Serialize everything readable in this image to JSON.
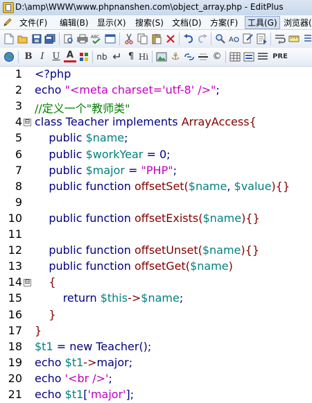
{
  "window": {
    "title": "D:\\amp\\WWW\\www.phpnanshen.com\\object_array.php - EditPlus"
  },
  "menu": {
    "items": [
      "文件(F)",
      "编辑(B)",
      "显示(X)",
      "搜索(S)",
      "文档(D)",
      "方案(F)",
      "工具(G)",
      "浏览器("
    ],
    "active": "工具(G)"
  },
  "toolbar2": {
    "nb": "nb",
    "hi": "Hi",
    "pre": "PRE"
  },
  "editor": {
    "line_numbers": [
      "1",
      "2",
      "3",
      "4",
      "5",
      "6",
      "7",
      "8",
      "9",
      "10",
      "11",
      "12",
      "13",
      "14",
      "15",
      "16",
      "17",
      "18",
      "19",
      "20",
      "21"
    ],
    "fold_markers": [
      "⊟",
      "⊟"
    ],
    "lines": [
      [
        {
          "t": "<?php",
          "c": "kw"
        }
      ],
      [
        {
          "t": "echo ",
          "c": "kw"
        },
        {
          "t": "\"<meta charset='utf-8' />\"",
          "c": "str"
        },
        {
          "t": ";",
          "c": "kw"
        }
      ],
      [
        {
          "t": "//定义一个\"教师类\"",
          "c": "cmt"
        }
      ],
      [
        {
          "t": "class Teacher implements ",
          "c": "kw"
        },
        {
          "t": "ArrayAccess",
          "c": "fn"
        },
        {
          "t": "{",
          "c": "op"
        }
      ],
      [
        {
          "t": "    public ",
          "c": "kw"
        },
        {
          "t": "$name",
          "c": "var"
        },
        {
          "t": ";",
          "c": "kw"
        }
      ],
      [
        {
          "t": "    public ",
          "c": "kw"
        },
        {
          "t": "$workYear",
          "c": "var"
        },
        {
          "t": " = 0;",
          "c": "kw"
        }
      ],
      [
        {
          "t": "    public ",
          "c": "kw"
        },
        {
          "t": "$major",
          "c": "var"
        },
        {
          "t": " = ",
          "c": "kw"
        },
        {
          "t": "\"PHP\"",
          "c": "str"
        },
        {
          "t": ";",
          "c": "kw"
        }
      ],
      [
        {
          "t": "    public function ",
          "c": "kw"
        },
        {
          "t": "offsetSet(",
          "c": "fn"
        },
        {
          "t": "$name",
          "c": "var"
        },
        {
          "t": ", ",
          "c": "kw"
        },
        {
          "t": "$value",
          "c": "var"
        },
        {
          "t": "){}",
          "c": "fn"
        }
      ],
      [
        {
          "t": "",
          "c": "kw"
        }
      ],
      [
        {
          "t": "    public function ",
          "c": "kw"
        },
        {
          "t": "offsetExists(",
          "c": "fn"
        },
        {
          "t": "$name",
          "c": "var"
        },
        {
          "t": "){}",
          "c": "fn"
        }
      ],
      [
        {
          "t": "",
          "c": "kw"
        }
      ],
      [
        {
          "t": "    public function ",
          "c": "kw"
        },
        {
          "t": "offsetUnset(",
          "c": "fn"
        },
        {
          "t": "$name",
          "c": "var"
        },
        {
          "t": "){}",
          "c": "fn"
        }
      ],
      [
        {
          "t": "    public function ",
          "c": "kw"
        },
        {
          "t": "offsetGet(",
          "c": "fn"
        },
        {
          "t": "$name",
          "c": "var"
        },
        {
          "t": ")",
          "c": "fn"
        }
      ],
      [
        {
          "t": "    {",
          "c": "op"
        }
      ],
      [
        {
          "t": "        return ",
          "c": "kw"
        },
        {
          "t": "$this",
          "c": "var"
        },
        {
          "t": "->",
          "c": "op"
        },
        {
          "t": "$name",
          "c": "var"
        },
        {
          "t": ";",
          "c": "kw"
        }
      ],
      [
        {
          "t": "    }",
          "c": "op"
        }
      ],
      [
        {
          "t": "}",
          "c": "op"
        }
      ],
      [
        {
          "t": "$t1",
          "c": "var"
        },
        {
          "t": " = new Teacher();",
          "c": "kw"
        }
      ],
      [
        {
          "t": "echo ",
          "c": "kw"
        },
        {
          "t": "$t1",
          "c": "var"
        },
        {
          "t": "->",
          "c": "op"
        },
        {
          "t": "major;",
          "c": "kw"
        }
      ],
      [
        {
          "t": "echo ",
          "c": "kw"
        },
        {
          "t": "'<br />'",
          "c": "str"
        },
        {
          "t": ";",
          "c": "kw"
        }
      ],
      [
        {
          "t": "echo ",
          "c": "kw"
        },
        {
          "t": "$t1",
          "c": "var"
        },
        {
          "t": "[",
          "c": "kw"
        },
        {
          "t": "'major'",
          "c": "str"
        },
        {
          "t": "];",
          "c": "kw"
        }
      ]
    ]
  }
}
